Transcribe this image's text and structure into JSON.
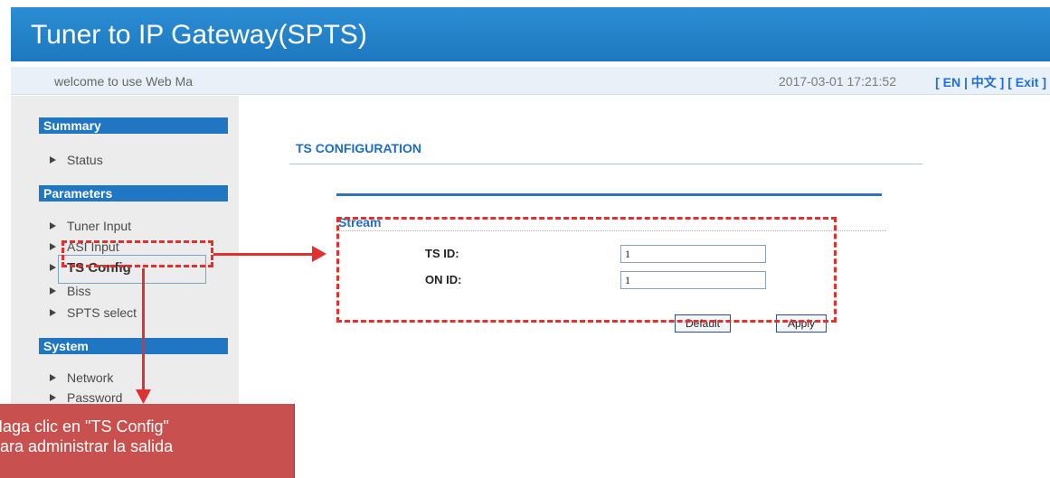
{
  "header": {
    "title": "Tuner to IP Gateway(SPTS)"
  },
  "subbar": {
    "welcome": "welcome to use Web Ma",
    "datetime": "2017-03-01 17:21:52",
    "lang_links": "[ EN | 中文 ]  [ Exit ]"
  },
  "sidebar": {
    "sections": [
      {
        "title": "Summary",
        "items": [
          "Status"
        ]
      },
      {
        "title": "Parameters",
        "items": [
          "Tuner Input",
          "ASI Input",
          "TS Config",
          "Biss",
          "SPTS select"
        ]
      },
      {
        "title": "System",
        "items": [
          "Network",
          "Password"
        ]
      }
    ],
    "active": "TS Config"
  },
  "main": {
    "title": "TS CONFIGURATION",
    "stream_label": "Stream",
    "fields": [
      {
        "label": "TS ID:",
        "value": "1"
      },
      {
        "label": "ON ID:",
        "value": "1"
      }
    ],
    "buttons": {
      "default": "Default",
      "apply": "Apply"
    }
  },
  "annotation": {
    "line1": "Haga clic en \"TS Config\"",
    "line2": "para administrar la salida"
  },
  "colors": {
    "accent": "#1f77c3",
    "annotation": "#e0302f",
    "callout_bg": "#c8504e"
  }
}
